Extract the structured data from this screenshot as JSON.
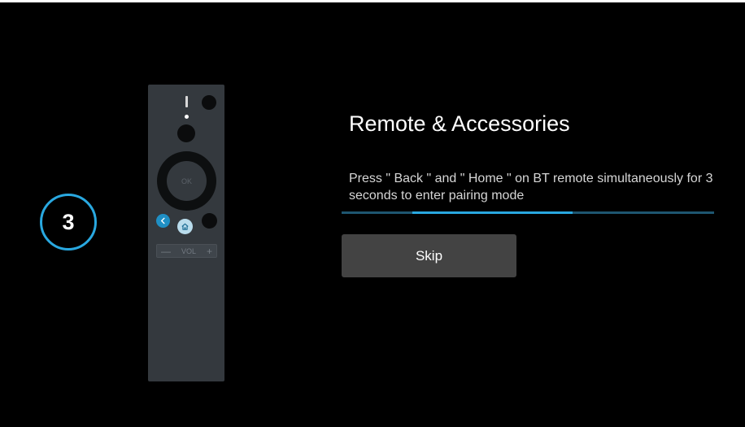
{
  "step": {
    "number": "3"
  },
  "remote": {
    "ok_label": "OK",
    "vol_minus": "—",
    "vol_label": "VOL",
    "vol_plus": "+"
  },
  "content": {
    "title": "Remote & Accessories",
    "description": "Press \" Back \" and \" Home \" on BT remote simultaneously for 3 seconds to enter pairing mode"
  },
  "progress": {
    "start_fraction": 0.19,
    "end_fraction": 0.62
  },
  "actions": {
    "skip_label": "Skip"
  },
  "colors": {
    "accent": "#29a8e0",
    "background": "#000000",
    "button_bg": "#434343"
  }
}
